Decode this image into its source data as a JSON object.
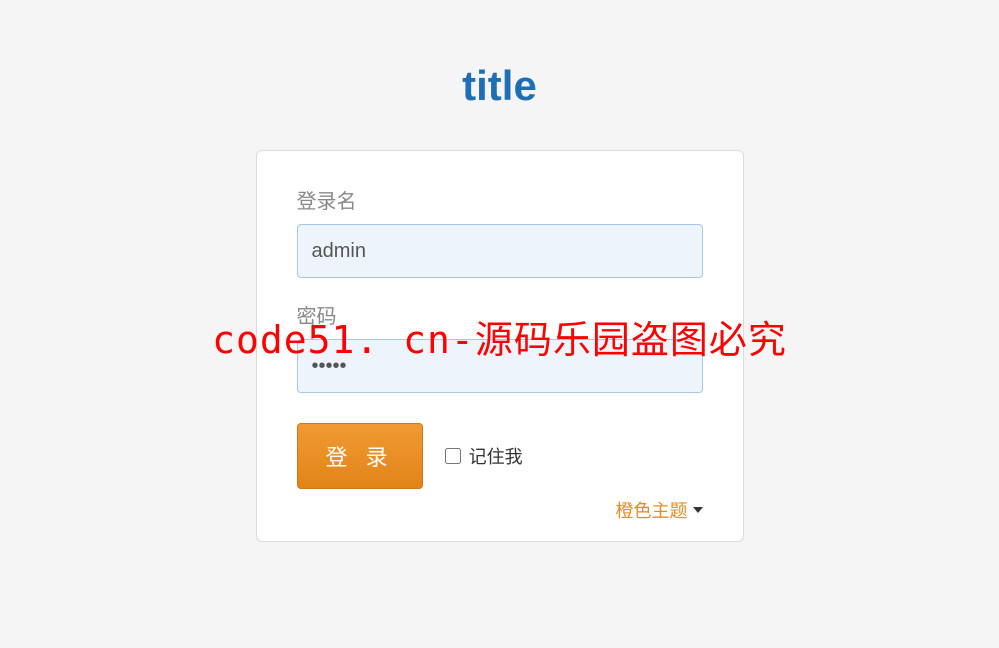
{
  "page": {
    "title": "title"
  },
  "form": {
    "username": {
      "label": "登录名",
      "value": "admin"
    },
    "password": {
      "label": "密码",
      "value": "•••••"
    },
    "login_button": "登 录",
    "remember": {
      "label": "记住我",
      "checked": false
    }
  },
  "theme": {
    "selected": "橙色主题"
  },
  "watermark": "code51. cn-源码乐园盗图必究"
}
